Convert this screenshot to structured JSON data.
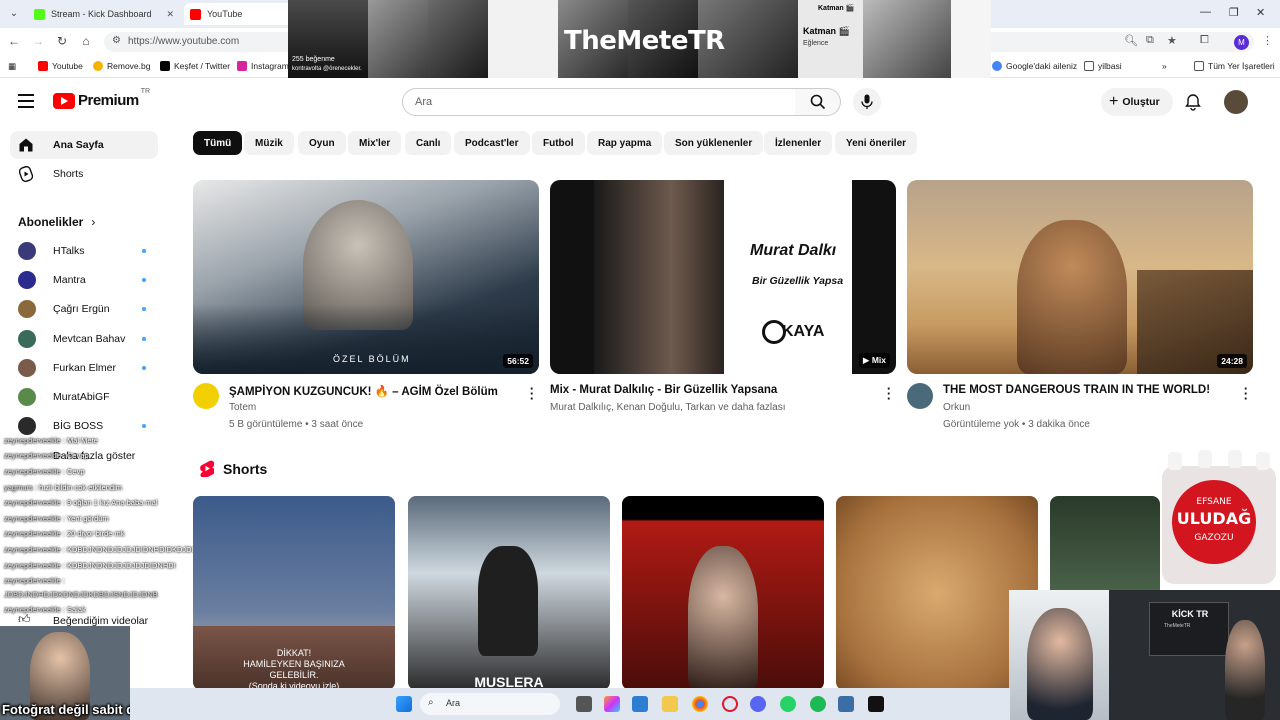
{
  "browser": {
    "tabs": [
      {
        "title": "Stream - Kick Dashboard",
        "active": false
      },
      {
        "title": "YouTube",
        "active": true
      }
    ],
    "url": "https://www.youtube.com",
    "profile_initial": "M",
    "bookmarks": [
      "Youtube",
      "Remove.bg",
      "Keşfet / Twitter",
      "Instagram",
      "Google'daki aileniz",
      "yilbasi",
      "Tüm Yer İşaretleri"
    ]
  },
  "banner": {
    "title": "TheMeteTR",
    "story_caption": "255 beğenme",
    "story_sub": "kontravolta @örenecekler.",
    "thumb_title_1": "Katman 🎬",
    "thumb_title_2": "Katman 🎬",
    "thumb_sub": "Eğlence"
  },
  "header": {
    "logo_text": "Premium",
    "logo_region": "TR",
    "search_placeholder": "Ara",
    "create_label": "Oluştur"
  },
  "sidebar": {
    "nav": [
      {
        "label": "Ana Sayfa",
        "icon": "home-icon",
        "active": true
      },
      {
        "label": "Shorts",
        "icon": "shorts-icon",
        "active": false
      }
    ],
    "subscriptions_title": "Abonelikler",
    "subscriptions": [
      {
        "name": "HTalks",
        "color": "#3a3a7a",
        "live_dot": true
      },
      {
        "name": "Mantra",
        "color": "#2b2b8f",
        "live_dot": true
      },
      {
        "name": "Çağrı Ergün",
        "color": "#8a6a3a",
        "live_dot": true
      },
      {
        "name": "Mevtcan Bahav",
        "color": "#3a6a5a",
        "live_dot": true
      },
      {
        "name": "Furkan Elmer",
        "color": "#7a5a4a",
        "live_dot": true
      },
      {
        "name": "MuratAbiGF",
        "color": "#5a8a4a",
        "live_dot": false
      },
      {
        "name": "BİG BOSS",
        "color": "#2a2a2a",
        "live_dot": true
      }
    ],
    "show_more": "Daha fazla göster",
    "liked_videos": "Beğendiğim videolar"
  },
  "chat": [
    {
      "user": "zeynepderveekle",
      "msg": "Mal Mete"
    },
    {
      "user": "zeynepderveekle",
      "msg": "Cevap"
    },
    {
      "user": "zeynepderveekle",
      "msg": "Cevp"
    },
    {
      "user": "yagmurs",
      "msg": "hızlı bildin cok etkilendim"
    },
    {
      "user": "zeynepderveekle",
      "msg": "9 oğlan 1 kız Ana baba mal"
    },
    {
      "user": "zeynepderveekle",
      "msg": "Yeni gördüm"
    },
    {
      "user": "zeynepderveekle",
      "msg": "20 diyor birde mk"
    },
    {
      "user": "zeynepderveekle",
      "msg": "KDBDJNDNDJDJDJDIDNHDIDKDJDIND"
    },
    {
      "user": "zeynepderveekle",
      "msg": "KDBDJNDNDJDJDJDJDIDNHDI"
    },
    {
      "user": "zeynepderveekle",
      "msg": ""
    },
    {
      "user": "JDBDJNDHDJDKDNDJDKDBDJSNDJDJDNB",
      "msg": ""
    },
    {
      "user": "zeynepderveekle",
      "msg": "Salak"
    }
  ],
  "chips": [
    "Tümü",
    "Müzik",
    "Oyun",
    "Mix'ler",
    "Canlı",
    "Podcast'ler",
    "Futbol",
    "Rap yapma",
    "Son yüklenenler",
    "İzlenenler",
    "Yeni öneriler"
  ],
  "videos": [
    {
      "title": "ŞAMPİYON KUZGUNCUK! 🔥 – AGİM Özel Bölüm",
      "channel": "Totem",
      "meta": "5 B görüntüleme • 3 saat önce",
      "duration": "56:52",
      "thumb_text": "ÖZEL BÖLÜM"
    },
    {
      "title": "Mix - Murat Dalkılıç - Bir Güzellik Yapsana",
      "channel": "Murat Dalkılıç, Kenan Doğulu, Tarkan ve daha fazlası",
      "meta": "",
      "duration": "Mix",
      "thumb_text": "Murat Dalkı",
      "thumb_sub": "Bir Güzellik Yapsa",
      "thumb_logo": "KAYA"
    },
    {
      "title": "THE MOST DANGEROUS TRAIN IN THE WORLD!",
      "channel": "Orkun",
      "meta": "Görüntüleme yok • 3 dakika önce",
      "duration": "24:28"
    }
  ],
  "shorts_title": "Shorts",
  "shorts": [
    {
      "text": ""
    },
    {
      "text": "MUSLERA"
    },
    {
      "text": ""
    },
    {
      "text": ""
    },
    {
      "text": ""
    }
  ],
  "shorts_sub_caption": "DİKKAT!\nHAMİLEYKEN BAŞINIZA\nGELEBİLİR.\n(Sonda ki videoyu izle)",
  "taskbar": {
    "search_placeholder": "Ara"
  },
  "overlay": {
    "caption": "Fotoğrat değil sabit duruyorum",
    "bottle_brand": "ULUDAĞ",
    "bottle_top": "EFSANE",
    "bottle_bottom": "GAZOZU",
    "screen_title": "KİCK TR",
    "screen_sub": "TheMeteTR"
  }
}
